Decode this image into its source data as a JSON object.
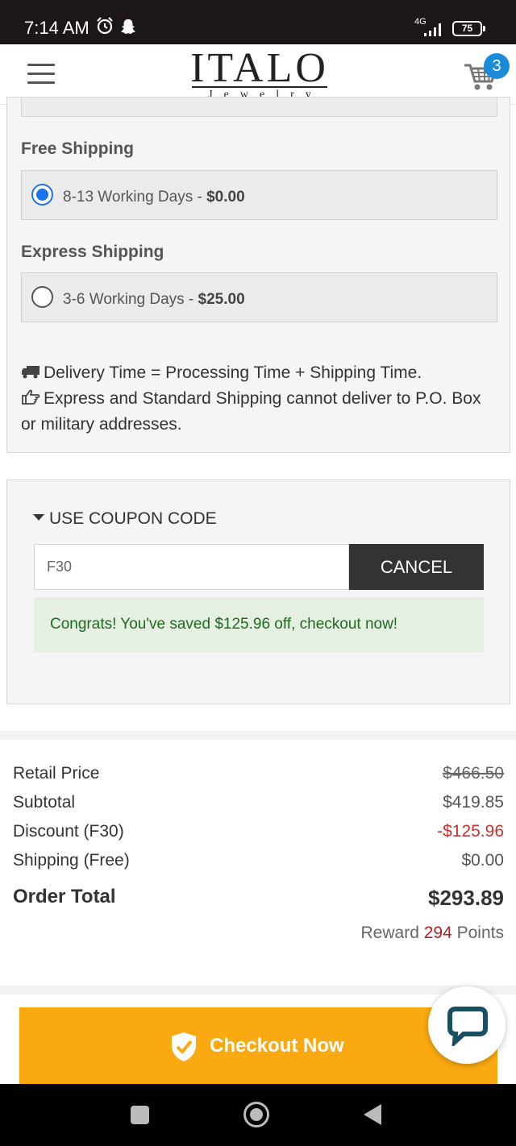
{
  "status_bar": {
    "time": "7:14 AM",
    "network": "4G",
    "battery": "75"
  },
  "header": {
    "logo_main": "ITALO",
    "logo_sub": "Jewelry",
    "cart_count": "3"
  },
  "shipping": {
    "free": {
      "heading": "Free Shipping",
      "days": "8-13 Working Days - ",
      "price": "$0.00",
      "selected": true
    },
    "express": {
      "heading": "Express Shipping",
      "days": "3-6 Working Days - ",
      "price": "$25.00",
      "selected": false
    },
    "note_delivery": "Delivery Time = Processing Time + Shipping Time.",
    "note_po_box": "Express and Standard Shipping cannot deliver to P.O. Box or military addresses."
  },
  "coupon": {
    "title": "USE COUPON CODE",
    "code": "F30",
    "cancel_label": "CANCEL",
    "success_message": "Congrats! You've saved $125.96 off, checkout now!"
  },
  "summary": {
    "retail_label": "Retail Price",
    "retail_value": "$466.50",
    "subtotal_label": "Subtotal",
    "subtotal_value": "$419.85",
    "discount_label": "Discount (F30)",
    "discount_value": "-$125.96",
    "shipping_label": "Shipping (Free)",
    "shipping_value": "$0.00",
    "total_label": "Order Total",
    "total_value": "$293.89",
    "reward_prefix": "Reward",
    "reward_points": "294",
    "reward_suffix": "Points"
  },
  "checkout": {
    "label": "Checkout Now"
  },
  "colors": {
    "accent": "#fba910",
    "radio": "#1a73e8",
    "badge": "#1b8ad8",
    "discount": "#c9302c",
    "success_bg": "#e5f0e2",
    "success_text": "#1e6b1e"
  }
}
